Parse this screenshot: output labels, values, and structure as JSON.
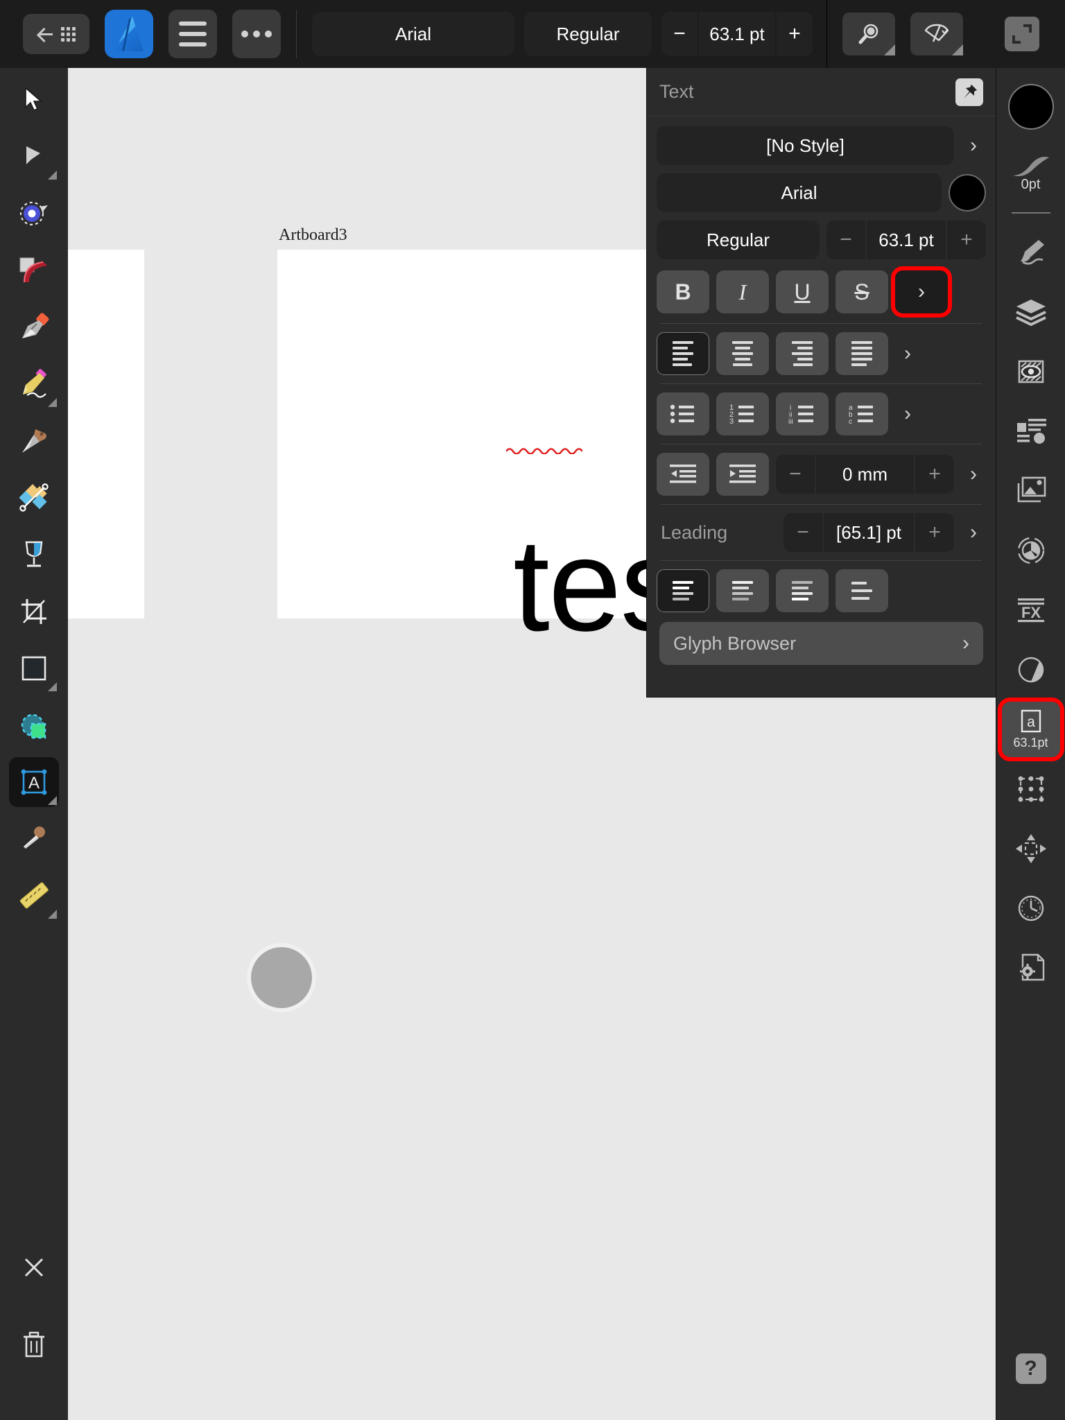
{
  "topbar": {
    "back_icon": "back-arrow-icon",
    "grid_icon": "grid-icon",
    "app_logo": "affinity-designer-logo",
    "menu_icon": "hamburger-menu-icon",
    "more_icon": "more-options-icon",
    "font_family": "Arial",
    "font_style": "Regular",
    "size_minus": "−",
    "font_size": "63.1 pt",
    "size_plus": "+",
    "zoom_icon": "magnifier-icon",
    "view_icon": "preview-fan-icon",
    "fullscreen_icon": "fullscreen-icon"
  },
  "left_tools": [
    {
      "name": "move-tool",
      "icon": "cursor-arrow-icon",
      "selected": false,
      "has_submenu": false
    },
    {
      "name": "node-tool",
      "icon": "node-arrow-icon",
      "selected": false,
      "has_submenu": true
    },
    {
      "name": "corner-tool",
      "icon": "corner-target-icon",
      "selected": false,
      "has_submenu": false
    },
    {
      "name": "vector-brush-tool",
      "icon": "vector-brush-icon",
      "selected": false,
      "has_submenu": false
    },
    {
      "name": "pen-tool",
      "icon": "pen-nib-icon",
      "selected": false,
      "has_submenu": false
    },
    {
      "name": "pencil-tool",
      "icon": "pencil-icon",
      "selected": false,
      "has_submenu": true
    },
    {
      "name": "knife-tool",
      "icon": "knife-icon",
      "selected": false,
      "has_submenu": false
    },
    {
      "name": "shape-builder-tool",
      "icon": "shape-builder-icon",
      "selected": false,
      "has_submenu": false
    },
    {
      "name": "fill-tool",
      "icon": "wine-glass-fill-icon",
      "selected": false,
      "has_submenu": false
    },
    {
      "name": "crop-tool",
      "icon": "crop-icon",
      "selected": false,
      "has_submenu": false
    },
    {
      "name": "rectangle-tool",
      "icon": "rectangle-icon",
      "selected": false,
      "has_submenu": true
    },
    {
      "name": "selection-brush-tool",
      "icon": "selection-brush-icon",
      "selected": false,
      "has_submenu": false
    },
    {
      "name": "text-tool",
      "icon": "text-frame-a-icon",
      "selected": true,
      "has_submenu": true
    },
    {
      "name": "color-picker-tool",
      "icon": "eyedropper-icon",
      "selected": false,
      "has_submenu": false
    },
    {
      "name": "measure-tool",
      "icon": "ruler-icon",
      "selected": false,
      "has_submenu": true
    }
  ],
  "left_bottom": [
    {
      "name": "close-button",
      "icon": "close-x-icon"
    },
    {
      "name": "delete-button",
      "icon": "trash-icon"
    }
  ],
  "canvas": {
    "artboard_label": "Artboard3",
    "artboard_text": "test o",
    "spellcheck_underline": "red-squiggle",
    "handle": "text-cursor-handle"
  },
  "text_panel": {
    "title": "Text",
    "pin_icon": "pin-icon",
    "style_value": "[No Style]",
    "style_chevron": "›",
    "font_family": "Arial",
    "text_color": "#000000",
    "font_style": "Regular",
    "size_minus": "−",
    "font_size": "63.1 pt",
    "size_plus": "+",
    "decorations": [
      {
        "name": "bold-button",
        "label": "B",
        "active": false
      },
      {
        "name": "italic-button",
        "label": "I",
        "active": false
      },
      {
        "name": "underline-button",
        "label": "U",
        "active": false
      },
      {
        "name": "strikethrough-button",
        "label": "S",
        "active": false
      }
    ],
    "decorations_chevron": "›",
    "decorations_chevron_highlighted": true,
    "alignments": [
      {
        "name": "align-left-button",
        "icon": "align-left-icon",
        "active": true
      },
      {
        "name": "align-center-button",
        "icon": "align-center-icon",
        "active": false
      },
      {
        "name": "align-right-button",
        "icon": "align-right-icon",
        "active": false
      },
      {
        "name": "align-justify-button",
        "icon": "align-justify-icon",
        "active": false
      }
    ],
    "alignments_chevron": "›",
    "lists": [
      {
        "name": "bullet-list-button",
        "icon": "bullet-list-icon",
        "markers": [
          "•",
          "•",
          "•"
        ]
      },
      {
        "name": "numbered-list-button",
        "icon": "numbered-list-icon",
        "markers": [
          "1",
          "2",
          "3"
        ]
      },
      {
        "name": "roman-list-button",
        "icon": "roman-list-icon",
        "markers": [
          "i",
          "ii",
          "iii"
        ]
      },
      {
        "name": "alpha-list-button",
        "icon": "alpha-list-icon",
        "markers": [
          "a",
          "b",
          "c"
        ]
      }
    ],
    "lists_chevron": "›",
    "indent_decrease": "indent-decrease-icon",
    "indent_increase": "indent-increase-icon",
    "indent_minus": "−",
    "indent_value": "0 mm",
    "indent_plus": "+",
    "indent_chevron": "›",
    "leading_label": "Leading",
    "leading_minus": "−",
    "leading_value": "[65.1] pt",
    "leading_plus": "+",
    "leading_chevron": "›",
    "vertical_alignments": [
      {
        "name": "text-valign-top-button",
        "icon": "valign-top-icon",
        "active": true
      },
      {
        "name": "text-valign-middle-button",
        "icon": "valign-middle-icon",
        "active": false
      },
      {
        "name": "text-valign-bottom-button",
        "icon": "valign-bottom-icon",
        "active": false
      },
      {
        "name": "text-valign-justify-button",
        "icon": "valign-justify-icon",
        "active": false
      }
    ],
    "glyph_browser_label": "Glyph Browser",
    "glyph_browser_chevron": "›"
  },
  "right_sidebar": {
    "fill_color": "#000000",
    "stroke_width": "0pt",
    "items": [
      {
        "name": "fill-swatch",
        "icon": "fill-color-circle-icon"
      },
      {
        "name": "stroke-width-control",
        "icon": "stroke-curve-icon",
        "label": "0pt"
      },
      {
        "name": "brushes-panel-button",
        "icon": "paintbrush-icon"
      },
      {
        "name": "layers-panel-button",
        "icon": "layers-stack-icon"
      },
      {
        "name": "mask-panel-button",
        "icon": "mask-eye-icon"
      },
      {
        "name": "content-panel-button",
        "icon": "content-list-icon"
      },
      {
        "name": "assets-panel-button",
        "icon": "image-stack-icon"
      },
      {
        "name": "adjustment-panel-button",
        "icon": "color-wheel-icon"
      },
      {
        "name": "effects-panel-button",
        "icon": "fx-icon"
      },
      {
        "name": "opacity-panel-button",
        "icon": "half-circle-icon"
      },
      {
        "name": "text-size-panel-button",
        "icon": "text-a-box-icon",
        "label": "63.1pt",
        "highlighted": true
      },
      {
        "name": "transform-panel-button",
        "icon": "transform-nodes-icon"
      },
      {
        "name": "move-panel-button",
        "icon": "move-arrows-icon"
      },
      {
        "name": "history-panel-button",
        "icon": "clock-history-icon"
      },
      {
        "name": "document-settings-button",
        "icon": "document-gear-icon"
      }
    ],
    "help_label": "?",
    "help_icon": "help-question-icon"
  }
}
